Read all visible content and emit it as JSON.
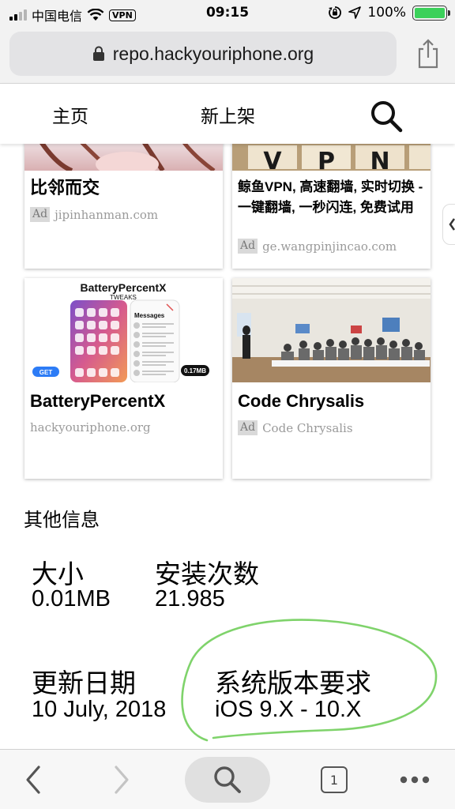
{
  "status_bar": {
    "carrier": "中国电信",
    "vpn": "VPN",
    "time": "09:15",
    "battery": "100%",
    "battery_level": 1.0
  },
  "browser": {
    "url": "repo.hackyouriphone.org",
    "tab_count": "1"
  },
  "site_nav": {
    "home": "主页",
    "new": "新上架"
  },
  "cards": [
    {
      "title": "比邻而交",
      "ad": "Ad",
      "source": "jipinhanman.com"
    },
    {
      "title": "鲸鱼VPN, 高速翻墙, 实时切换 - 一键翻墙, 一秒闪连, 免费试用",
      "ad": "Ad",
      "source": "ge.wangpinjincao.com",
      "image_text": "VPN"
    },
    {
      "title": "BatteryPercentX",
      "source": "hackyouriphone.org",
      "image_title": "BatteryPercentX",
      "image_subtitle": "TWEAKS",
      "get": "GET",
      "size": "0.17MB",
      "messages": "Messages"
    },
    {
      "title": "Code Chrysalis",
      "ad": "Ad",
      "source": "Code Chrysalis"
    }
  ],
  "info": {
    "heading": "其他信息",
    "size_label": "大小",
    "size_value": "0.01MB",
    "installs_label": "安装次数",
    "installs_value": "21.985",
    "updated_label": "更新日期",
    "updated_value": "10 July, 2018",
    "requirement_label": "系统版本要求",
    "requirement_value": "iOS 9.X - 10.X"
  },
  "colors": {
    "highlight_circle": "#7fd36b",
    "battery_fill": "#3bd15a"
  }
}
